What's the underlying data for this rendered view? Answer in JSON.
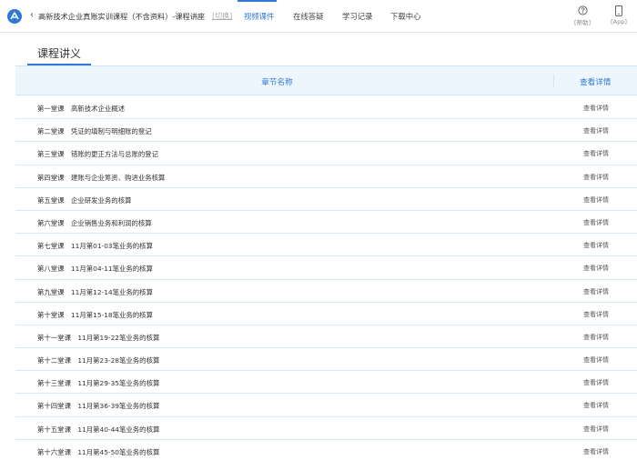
{
  "header": {
    "back_glyph": "‹",
    "course_title": "高新技术企业真账实训课程（不含资料）-课程讲座",
    "switch_label": "[切换]",
    "tabs": [
      {
        "label": "视频课件",
        "active": true
      },
      {
        "label": "在线答疑",
        "active": false
      },
      {
        "label": "学习记录",
        "active": false
      },
      {
        "label": "下载中心",
        "active": false
      }
    ],
    "help_label": "[帮助]",
    "app_label": "[App]"
  },
  "section": {
    "title": "课程讲义"
  },
  "table": {
    "col_name": "章节名称",
    "col_view": "查看详情",
    "rows": [
      {
        "name": "第一堂课　高新技术企业概述",
        "action": "查看详情"
      },
      {
        "name": "第二堂课　凭证的填制与明细账的登记",
        "action": "查看详情"
      },
      {
        "name": "第三堂课　错账的更正方法与总账的登记",
        "action": "查看详情"
      },
      {
        "name": "第四堂课　建账与企业筹资、购进业务核算",
        "action": "查看详情"
      },
      {
        "name": "第五堂课　企业研发业务的核算",
        "action": "查看详情"
      },
      {
        "name": "第六堂课　企业销售业务和利润的核算",
        "action": "查看详情"
      },
      {
        "name": "第七堂课　11月第01-03笔业务的核算",
        "action": "查看详情"
      },
      {
        "name": "第八堂课　11月第04-11笔业务的核算",
        "action": "查看详情"
      },
      {
        "name": "第九堂课　11月第12-14笔业务的核算",
        "action": "查看详情"
      },
      {
        "name": "第十堂课　11月第15-18笔业务的核算",
        "action": "查看详情"
      },
      {
        "name": "第十一堂课　11月第19-22笔业务的核算",
        "action": "查看详情"
      },
      {
        "name": "第十二堂课　11月第23-28笔业务的核算",
        "action": "查看详情"
      },
      {
        "name": "第十三堂课　11月第29-35笔业务的核算",
        "action": "查看详情"
      },
      {
        "name": "第十四堂课　11月第36-39笔业务的核算",
        "action": "查看详情"
      },
      {
        "name": "第十五堂课　11月第40-44笔业务的核算",
        "action": "查看详情"
      },
      {
        "name": "第十六堂课　11月第45-50笔业务的核算",
        "action": "查看详情"
      }
    ]
  },
  "colors": {
    "accent": "#2e78d6",
    "header_bg": "#eef6fd",
    "row_border": "#dbe9f6"
  },
  "icons": {
    "logo": "brand-logo-icon",
    "help": "question-circle-icon",
    "app": "phone-icon"
  }
}
